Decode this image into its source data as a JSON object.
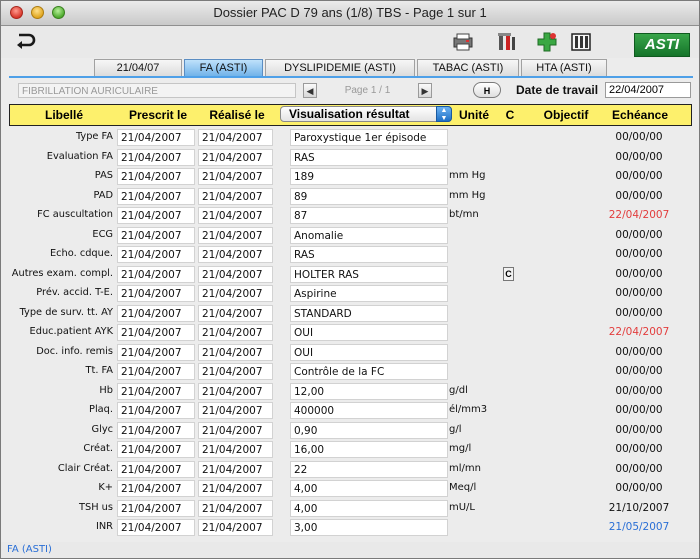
{
  "window": {
    "title": "Dossier PAC D 79 ans (1/8) TBS - Page 1 sur 1"
  },
  "toolbar": {
    "tools": [
      {
        "name": "printer-icon"
      },
      {
        "name": "tools-icon"
      },
      {
        "name": "add-cross-icon"
      },
      {
        "name": "columns-icon"
      }
    ],
    "logo": "ASTI"
  },
  "tabs": [
    {
      "label": "21/04/07",
      "active": false
    },
    {
      "label": "FA (ASTI)",
      "active": true
    },
    {
      "label": "DYSLIPIDEMIE (ASTI)",
      "active": false
    },
    {
      "label": "TABAC (ASTI)",
      "active": false
    },
    {
      "label": "HTA (ASTI)",
      "active": false
    }
  ],
  "infobar": {
    "diagnosis": "FIBRILLATION AURICULAIRE",
    "pager": "Page 1 / 1",
    "h_button": "H",
    "date_label": "Date de travail",
    "date_value": "22/04/2007"
  },
  "table": {
    "headers": {
      "libelle": "Libellé",
      "prescrit": "Prescrit le",
      "realise": "Réalisé le",
      "visualisation": "Visualisation résultat",
      "unite": "Unité",
      "c": "C",
      "objectif": "Objectif",
      "echeance": "Echéance"
    },
    "rows": [
      {
        "label": "Type FA",
        "prescrit": "21/04/2007",
        "realise": "21/04/2007",
        "resultat": "Paroxystique 1er épisode",
        "unite": "",
        "c": false,
        "echeance": "00/00/00",
        "overdue": false
      },
      {
        "label": "Evaluation FA",
        "prescrit": "21/04/2007",
        "realise": "21/04/2007",
        "resultat": "RAS",
        "unite": "",
        "c": false,
        "echeance": "00/00/00",
        "overdue": false
      },
      {
        "label": "PAS",
        "prescrit": "21/04/2007",
        "realise": "21/04/2007",
        "resultat": "189",
        "unite": "mm Hg",
        "c": false,
        "echeance": "00/00/00",
        "overdue": false
      },
      {
        "label": "PAD",
        "prescrit": "21/04/2007",
        "realise": "21/04/2007",
        "resultat": "89",
        "unite": "mm Hg",
        "c": false,
        "echeance": "00/00/00",
        "overdue": false
      },
      {
        "label": "FC auscultation",
        "prescrit": "21/04/2007",
        "realise": "21/04/2007",
        "resultat": "87",
        "unite": "bt/mn",
        "c": false,
        "echeance": "22/04/2007",
        "overdue": true
      },
      {
        "label": "ECG",
        "prescrit": "21/04/2007",
        "realise": "21/04/2007",
        "resultat": "Anomalie",
        "unite": "",
        "c": false,
        "echeance": "00/00/00",
        "overdue": false
      },
      {
        "label": "Echo. cdque.",
        "prescrit": "21/04/2007",
        "realise": "21/04/2007",
        "resultat": "RAS",
        "unite": "",
        "c": false,
        "echeance": "00/00/00",
        "overdue": false
      },
      {
        "label": "Autres exam. compl.",
        "prescrit": "21/04/2007",
        "realise": "21/04/2007",
        "resultat": "HOLTER RAS",
        "unite": "",
        "c": true,
        "echeance": "00/00/00",
        "overdue": false
      },
      {
        "label": "Prév. accid. T-E.",
        "prescrit": "21/04/2007",
        "realise": "21/04/2007",
        "resultat": "Aspirine",
        "unite": "",
        "c": false,
        "echeance": "00/00/00",
        "overdue": false
      },
      {
        "label": "Type de surv. tt. AY",
        "prescrit": "21/04/2007",
        "realise": "21/04/2007",
        "resultat": "STANDARD",
        "unite": "",
        "c": false,
        "echeance": "00/00/00",
        "overdue": false
      },
      {
        "label": "Educ.patient AYK",
        "prescrit": "21/04/2007",
        "realise": "21/04/2007",
        "resultat": "OUI",
        "unite": "",
        "c": false,
        "echeance": "22/04/2007",
        "overdue": true
      },
      {
        "label": "Doc. info. remis",
        "prescrit": "21/04/2007",
        "realise": "21/04/2007",
        "resultat": "OUI",
        "unite": "",
        "c": false,
        "echeance": "00/00/00",
        "overdue": false
      },
      {
        "label": "Tt. FA",
        "prescrit": "21/04/2007",
        "realise": "21/04/2007",
        "resultat": "Contrôle de la FC",
        "unite": "",
        "c": false,
        "echeance": "00/00/00",
        "overdue": false
      },
      {
        "label": "Hb",
        "prescrit": "21/04/2007",
        "realise": "21/04/2007",
        "resultat": "12,00",
        "unite": "g/dl",
        "c": false,
        "echeance": "00/00/00",
        "overdue": false
      },
      {
        "label": "Plaq.",
        "prescrit": "21/04/2007",
        "realise": "21/04/2007",
        "resultat": "400000",
        "unite": "él/mm3",
        "c": false,
        "echeance": "00/00/00",
        "overdue": false
      },
      {
        "label": "Glyc",
        "prescrit": "21/04/2007",
        "realise": "21/04/2007",
        "resultat": "0,90",
        "unite": "g/l",
        "c": false,
        "echeance": "00/00/00",
        "overdue": false
      },
      {
        "label": "Créat.",
        "prescrit": "21/04/2007",
        "realise": "21/04/2007",
        "resultat": "16,00",
        "unite": "mg/l",
        "c": false,
        "echeance": "00/00/00",
        "overdue": false
      },
      {
        "label": "Clair Créat.",
        "prescrit": "21/04/2007",
        "realise": "21/04/2007",
        "resultat": "22",
        "unite": "ml/mn",
        "c": false,
        "echeance": "00/00/00",
        "overdue": false
      },
      {
        "label": "K+",
        "prescrit": "21/04/2007",
        "realise": "21/04/2007",
        "resultat": "4,00",
        "unite": "Meq/l",
        "c": false,
        "echeance": "00/00/00",
        "overdue": false
      },
      {
        "label": "TSH us",
        "prescrit": "21/04/2007",
        "realise": "21/04/2007",
        "resultat": "4,00",
        "unite": "mU/L",
        "c": false,
        "echeance": "21/10/2007",
        "overdue": false
      },
      {
        "label": "INR",
        "prescrit": "21/04/2007",
        "realise": "21/04/2007",
        "resultat": "3,00",
        "unite": "",
        "c": false,
        "echeance": "21/05/2007",
        "overdue": false,
        "upcoming": true
      }
    ]
  },
  "status": {
    "text": "FA (ASTI)"
  },
  "colors": {
    "overdue": "#e23d3d",
    "upcoming": "#2a6fd6",
    "normal": "#111111",
    "header_bg": "#fdf06c",
    "tab_active": "#72b3e9"
  }
}
